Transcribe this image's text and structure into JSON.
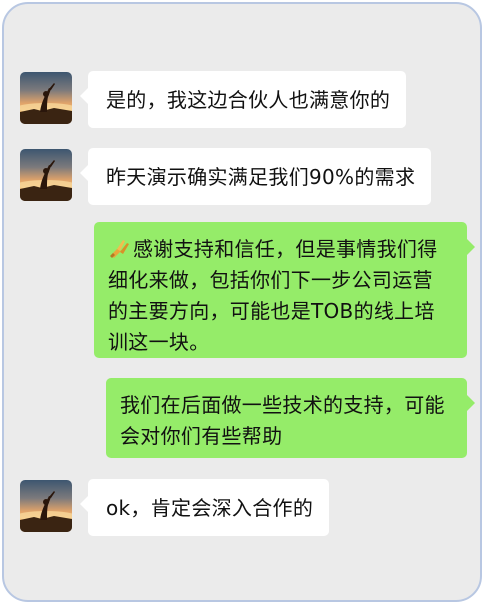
{
  "chat": {
    "messages": [
      {
        "side": "incoming",
        "text": "是的，我这边合伙人也满意你的"
      },
      {
        "side": "incoming",
        "text": "昨天演示确实满足我们90%的需求"
      },
      {
        "side": "outgoing",
        "emoji": "folded-hands-icon",
        "text": "感谢支持和信任，但是事情我们得细化来做，包括你们下一步公司运营的主要方向，可能也是TOB的线上培训这一块。"
      },
      {
        "side": "outgoing",
        "text": "我们在后面做一些技术的支持，可能会对你们有些帮助"
      },
      {
        "side": "incoming",
        "text": "ok，肯定会深入合作的"
      }
    ]
  },
  "colors": {
    "background": "#ebebeb",
    "incoming_bubble": "#ffffff",
    "outgoing_bubble": "#95ec69",
    "frame_border": "#b8c7e2"
  }
}
